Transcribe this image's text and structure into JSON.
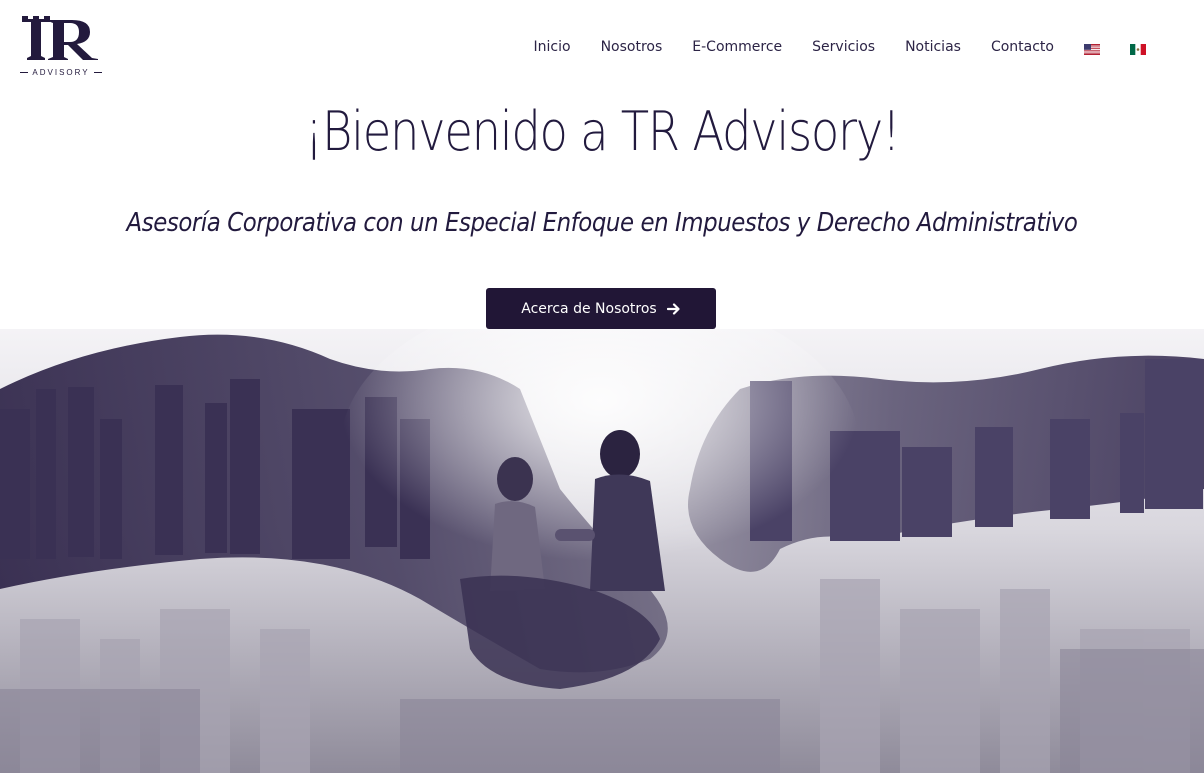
{
  "brand": {
    "logo_letters": "TR",
    "logo_word": "ADVISORY",
    "color_primary": "#211636"
  },
  "nav": {
    "items": [
      {
        "label": "Inicio"
      },
      {
        "label": "Nosotros"
      },
      {
        "label": "E-Commerce"
      },
      {
        "label": "Servicios"
      },
      {
        "label": "Noticias"
      },
      {
        "label": "Contacto"
      }
    ],
    "flags": [
      {
        "icon": "us-flag-icon"
      },
      {
        "icon": "mexico-flag-icon"
      }
    ]
  },
  "hero": {
    "title": "¡Bienvenido a TR Advisory!",
    "subtitle": "Asesoría Corporativa con un Especial Enfoque en Impuestos y Derecho Administrativo",
    "cta_label": "Acerca de Nosotros",
    "cta_icon": "arrow-right-icon",
    "image_icon": "handshake-city-skyline-photo"
  }
}
